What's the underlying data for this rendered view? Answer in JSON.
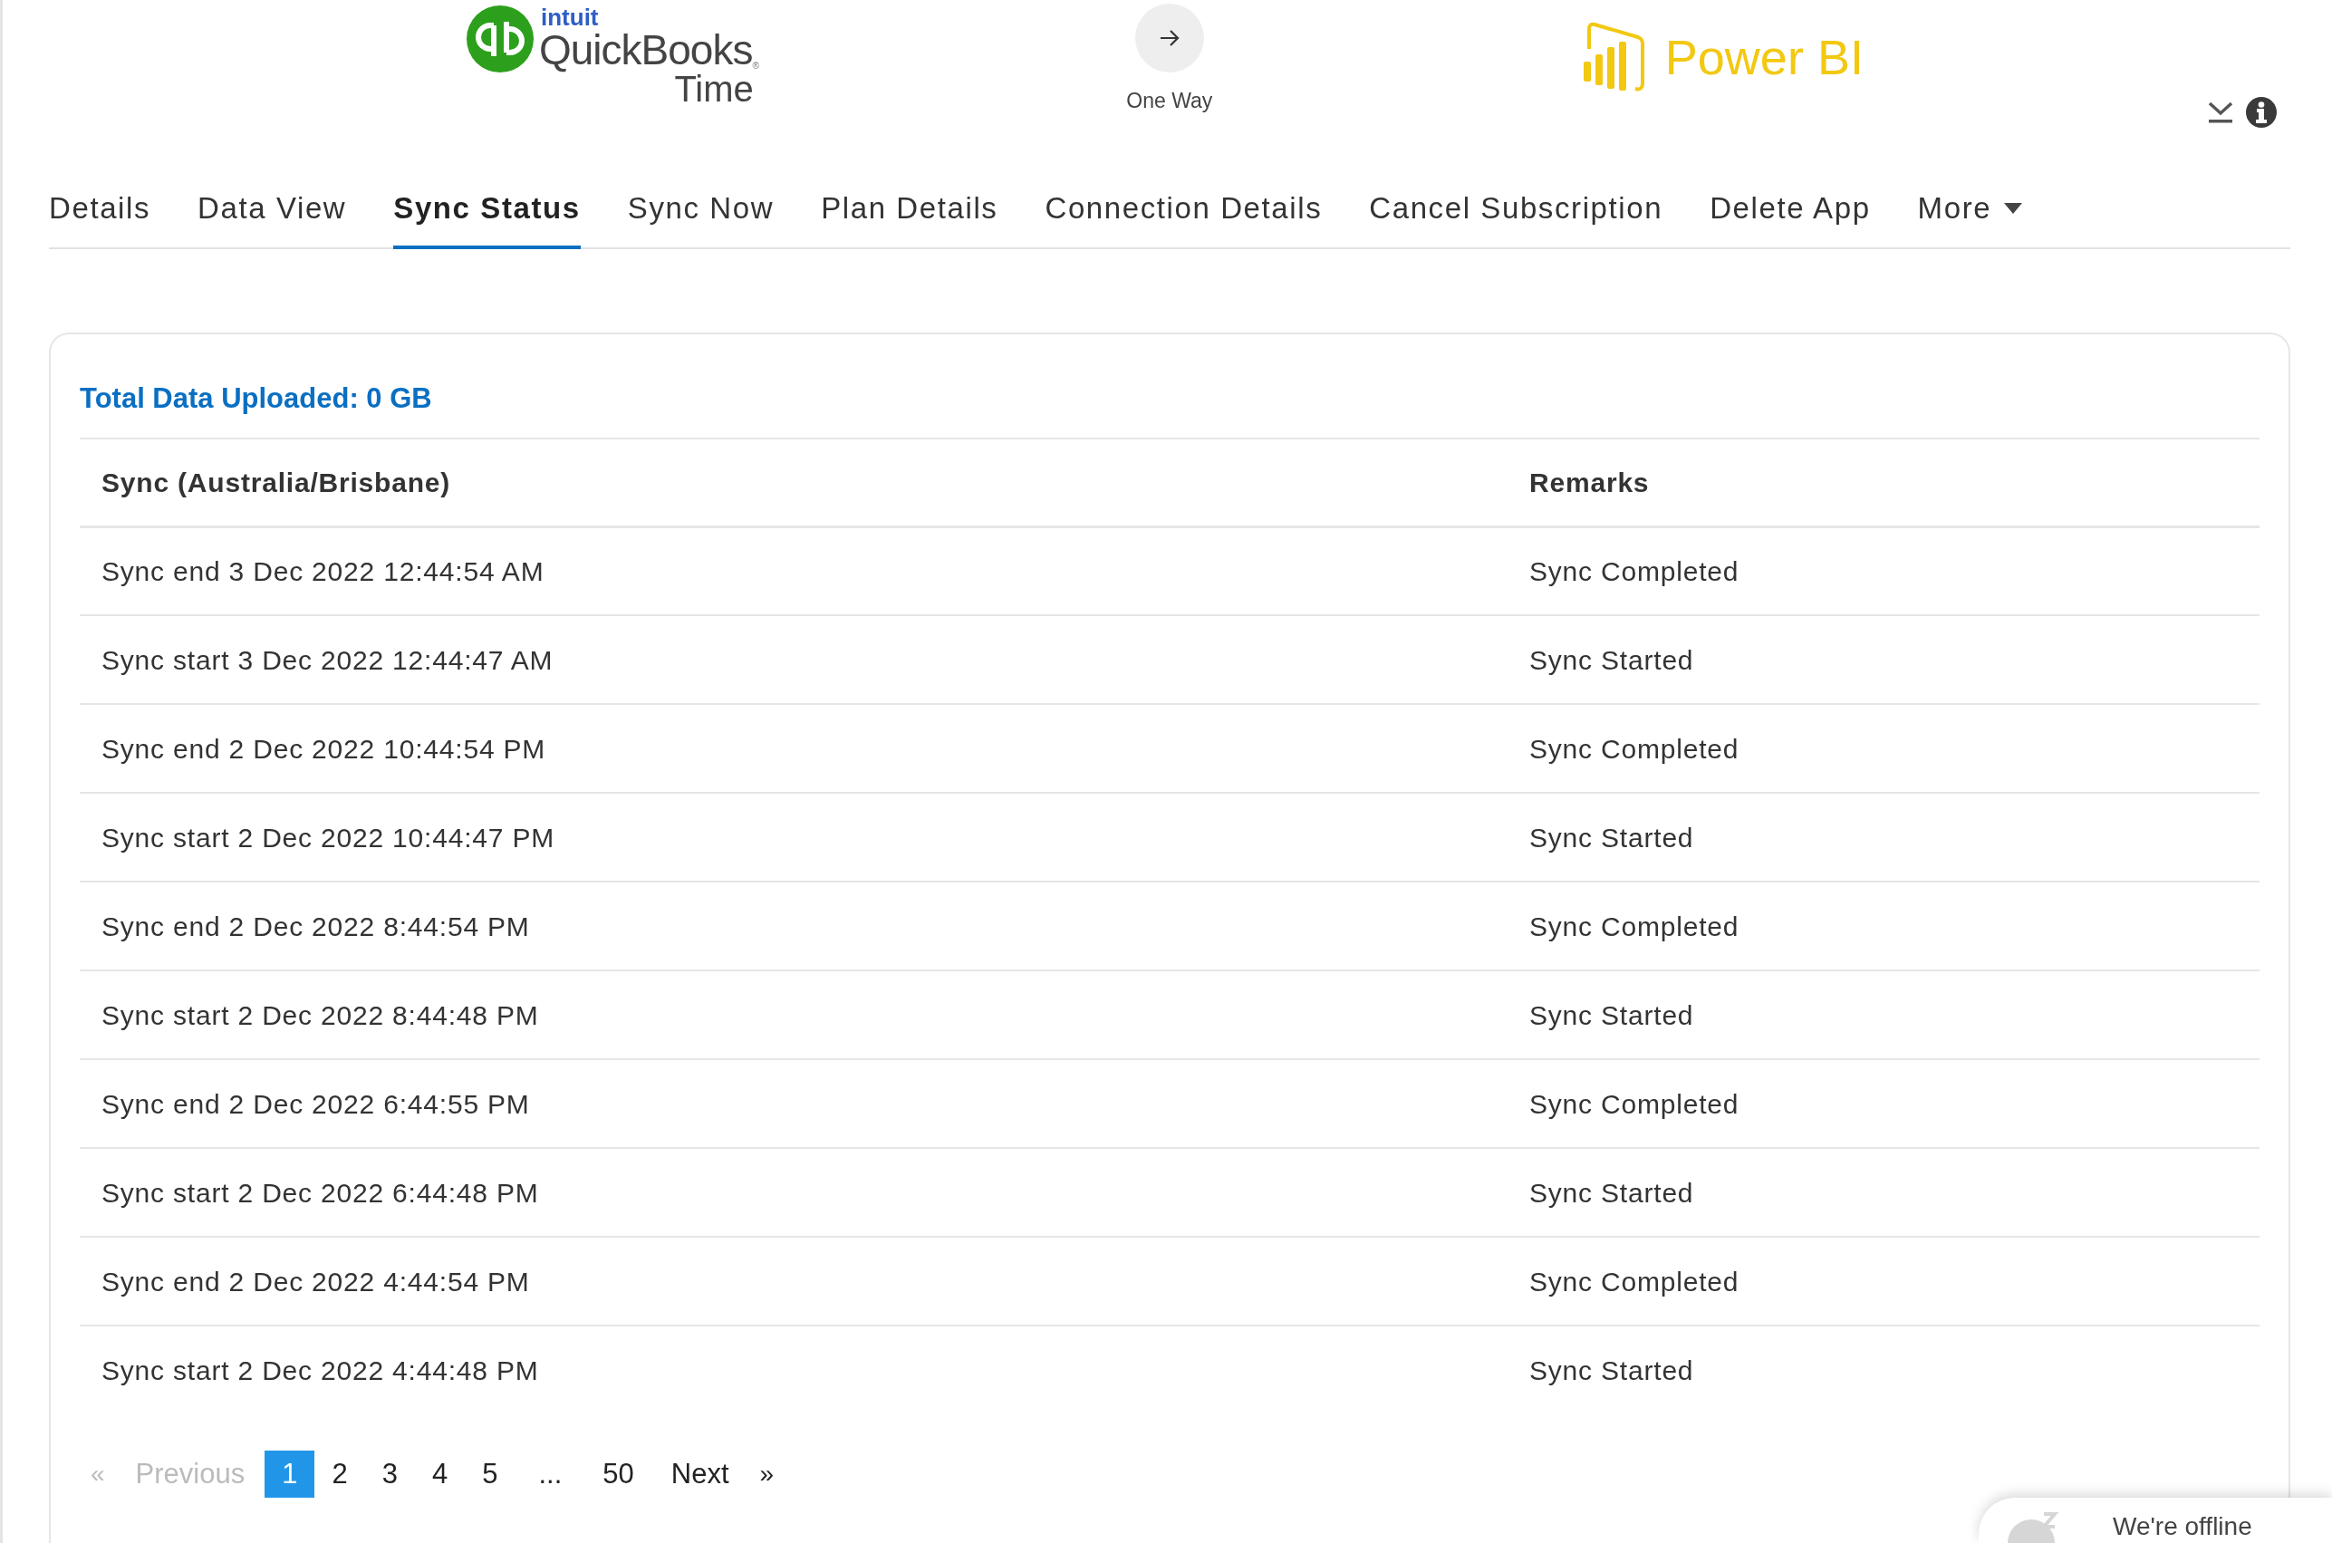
{
  "header": {
    "source_app": {
      "brand": "intuit",
      "name": "QuickBooks",
      "registered": "®",
      "product": "Time"
    },
    "direction": {
      "label": "One Way"
    },
    "target_app": {
      "name": "Power BI"
    }
  },
  "tabs": [
    {
      "label": "Details",
      "selected": false
    },
    {
      "label": "Data View",
      "selected": false
    },
    {
      "label": "Sync Status",
      "selected": true
    },
    {
      "label": "Sync Now",
      "selected": false
    },
    {
      "label": "Plan Details",
      "selected": false
    },
    {
      "label": "Connection Details",
      "selected": false
    },
    {
      "label": "Cancel Subscription",
      "selected": false
    },
    {
      "label": "Delete App",
      "selected": false
    },
    {
      "label": "More",
      "selected": false,
      "kind": "dropdown"
    }
  ],
  "summary": "Total Data Uploaded: 0 GB",
  "table": {
    "columns": [
      "Sync (Australia/Brisbane)",
      "Remarks"
    ],
    "rows": [
      [
        "Sync end 3 Dec 2022 12:44:54 AM",
        "Sync Completed"
      ],
      [
        "Sync start 3 Dec 2022 12:44:47 AM",
        "Sync Started"
      ],
      [
        "Sync end 2 Dec 2022 10:44:54 PM",
        "Sync Completed"
      ],
      [
        "Sync start 2 Dec 2022 10:44:47 PM",
        "Sync Started"
      ],
      [
        "Sync end 2 Dec 2022 8:44:54 PM",
        "Sync Completed"
      ],
      [
        "Sync start 2 Dec 2022 8:44:48 PM",
        "Sync Started"
      ],
      [
        "Sync end 2 Dec 2022 6:44:55 PM",
        "Sync Completed"
      ],
      [
        "Sync start 2 Dec 2022 6:44:48 PM",
        "Sync Started"
      ],
      [
        "Sync end 2 Dec 2022 4:44:54 PM",
        "Sync Completed"
      ],
      [
        "Sync start 2 Dec 2022 4:44:48 PM",
        "Sync Started"
      ]
    ]
  },
  "pagination": [
    {
      "label": "«",
      "kind": "arrow",
      "disabled": true,
      "selected": false
    },
    {
      "label": "Previous",
      "kind": "nav",
      "disabled": true,
      "selected": false
    },
    {
      "label": "1",
      "kind": "page",
      "disabled": false,
      "selected": true
    },
    {
      "label": "2",
      "kind": "page",
      "disabled": false,
      "selected": false
    },
    {
      "label": "3",
      "kind": "page",
      "disabled": false,
      "selected": false
    },
    {
      "label": "4",
      "kind": "page",
      "disabled": false,
      "selected": false
    },
    {
      "label": "5",
      "kind": "page",
      "disabled": false,
      "selected": false
    },
    {
      "label": "...",
      "kind": "gap"
    },
    {
      "label": "50",
      "kind": "page",
      "disabled": false,
      "selected": false
    },
    {
      "label": "Next",
      "kind": "nav",
      "disabled": false,
      "selected": false
    },
    {
      "label": "»",
      "kind": "arrow",
      "disabled": false,
      "selected": false
    }
  ],
  "chat_widget": {
    "status": "We're offline"
  }
}
